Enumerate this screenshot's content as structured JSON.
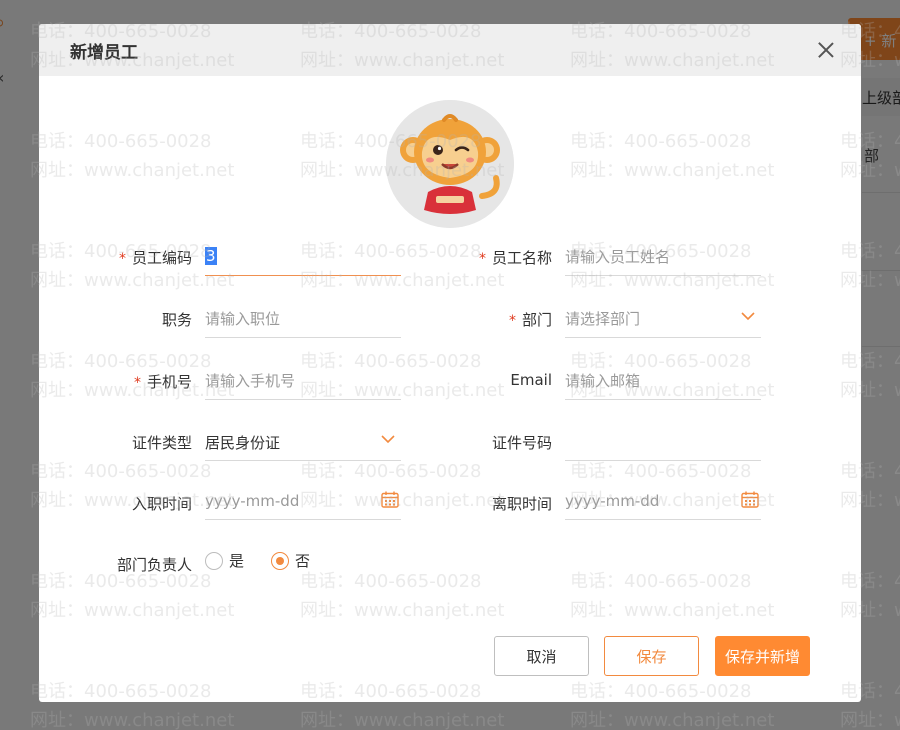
{
  "background": {
    "new_button_label": "+ 新",
    "column_header": "上级部",
    "row_text": "部"
  },
  "dialog": {
    "title": "新增员工",
    "close_icon": "close-icon",
    "avatar_icon": "monkey-mascot-avatar"
  },
  "form": {
    "employee_code": {
      "label": "员工编码",
      "required": true,
      "value": "3"
    },
    "employee_name": {
      "label": "员工名称",
      "required": true,
      "placeholder": "请输入员工姓名"
    },
    "position": {
      "label": "职务",
      "required": false,
      "placeholder": "请输入职位"
    },
    "department": {
      "label": "部门",
      "required": true,
      "placeholder": "请选择部门",
      "icon": "chevron-down-icon"
    },
    "phone": {
      "label": "手机号",
      "required": true,
      "placeholder": "请输入手机号"
    },
    "email": {
      "label": "Email",
      "required": false,
      "placeholder": "请输入邮箱"
    },
    "id_type": {
      "label": "证件类型",
      "required": false,
      "value": "居民身份证",
      "icon": "chevron-down-icon"
    },
    "id_number": {
      "label": "证件号码",
      "required": false,
      "value": ""
    },
    "hire_date": {
      "label": "入职时间",
      "placeholder": "yyyy-mm-dd",
      "icon": "calendar-icon"
    },
    "leave_date": {
      "label": "离职时间",
      "placeholder": "yyyy-mm-dd",
      "icon": "calendar-icon"
    },
    "dept_head": {
      "label": "部门负责人",
      "options": [
        "是",
        "否"
      ],
      "selected": "否"
    },
    "required_mark": "*"
  },
  "buttons": {
    "cancel": "取消",
    "save": "保存",
    "save_and_new": "保存并新增"
  },
  "watermark": {
    "phone": "电话：400-665-0028",
    "site": "网址：www.chanjet.net"
  },
  "colors": {
    "accent": "#ff8a32",
    "required": "#e03a1e",
    "header_bg": "#efefef"
  }
}
